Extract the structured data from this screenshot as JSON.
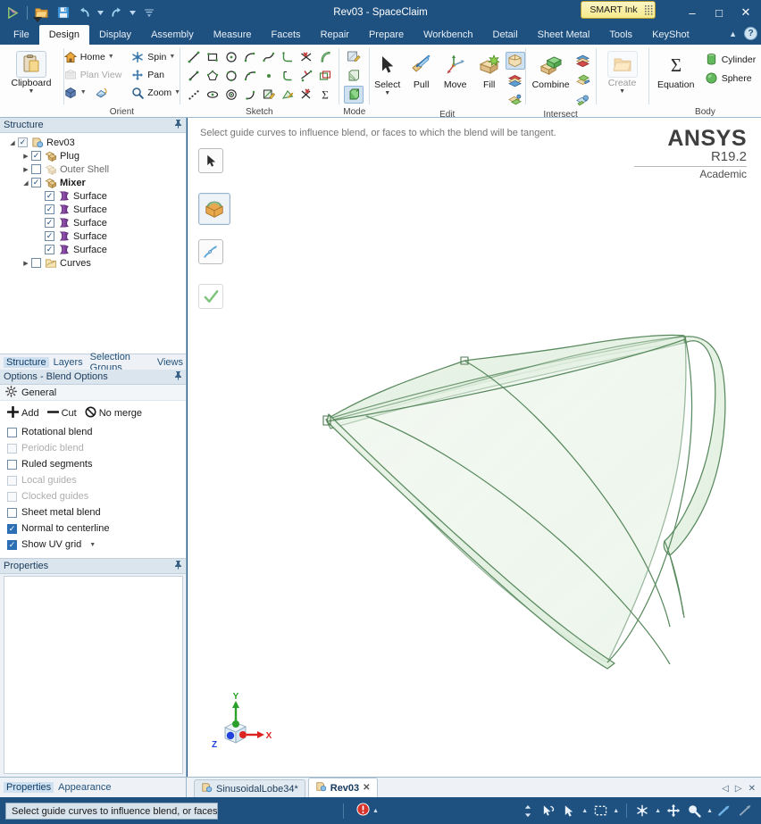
{
  "window": {
    "title": "Rev03 - SpaceClaim",
    "minimize": "–",
    "maximize": "□",
    "close": "✕"
  },
  "quick_access": {
    "items": [
      {
        "name": "app-menu-icon",
        "label": ""
      },
      {
        "name": "open-icon",
        "label": ""
      },
      {
        "name": "save-icon",
        "label": ""
      },
      {
        "name": "undo-icon",
        "label": ""
      },
      {
        "name": "redo-icon",
        "label": ""
      },
      {
        "name": "customize-qat-icon",
        "label": ""
      }
    ]
  },
  "smart_ink": {
    "label": "SMART Ink",
    "grip": "grip-icon"
  },
  "ribbon_tabs": {
    "items": [
      {
        "label": "File",
        "active": false
      },
      {
        "label": "Design",
        "active": true
      },
      {
        "label": "Display",
        "active": false
      },
      {
        "label": "Assembly",
        "active": false
      },
      {
        "label": "Measure",
        "active": false
      },
      {
        "label": "Facets",
        "active": false
      },
      {
        "label": "Repair",
        "active": false
      },
      {
        "label": "Prepare",
        "active": false
      },
      {
        "label": "Workbench",
        "active": false
      },
      {
        "label": "Detail",
        "active": false
      },
      {
        "label": "Sheet Metal",
        "active": false
      },
      {
        "label": "Tools",
        "active": false
      },
      {
        "label": "KeyShot",
        "active": false
      }
    ],
    "collapse": "▲",
    "help": "?"
  },
  "ribbon": {
    "clipboard": {
      "group_label": "",
      "button_label": "Clipboard",
      "caret": "▼"
    },
    "orient": {
      "group_label": "Orient",
      "items": [
        {
          "label": "Home",
          "icon": "home-icon",
          "caret": "▼",
          "disabled": false
        },
        {
          "label": "Spin",
          "icon": "spin-icon",
          "caret": "▼",
          "disabled": false
        },
        {
          "label": "Plan View",
          "icon": "plan-view-icon",
          "caret": "",
          "disabled": true
        },
        {
          "label": "Pan",
          "icon": "pan-icon",
          "caret": "",
          "disabled": false
        },
        {
          "label": "",
          "icon": "isometric-view-icon",
          "caret": "▼",
          "disabled": false
        },
        {
          "label": "",
          "icon": "view-orientation-icon",
          "caret": "",
          "disabled": false
        },
        {
          "label": "Zoom",
          "icon": "zoom-icon",
          "caret": "▼",
          "disabled": false
        }
      ]
    },
    "sketch": {
      "group_label": "Sketch",
      "icons": [
        "line-icon",
        "rectangle-icon",
        "circle-icon",
        "tangent-arc-icon",
        "spline-icon",
        "corner-arc-icon",
        "trim-away-icon",
        "arc-slice-icon",
        "construction-line-icon",
        "polygon-icon",
        "three-point-circle-icon",
        "three-point-arc-icon",
        "point-icon",
        "fillet-icon",
        "split-icon",
        "offset-icon",
        "dashed-line-icon",
        "ellipse-icon",
        "concentric-circle-icon",
        "sweep-arc-icon",
        "sketch-edit-icon",
        "project-icon",
        "trim-icon",
        "equation-curve-icon"
      ]
    },
    "mode": {
      "group_label": "Mode",
      "icons": [
        {
          "name": "sketch-mode-icon",
          "selected": false
        },
        {
          "name": "section-mode-icon",
          "selected": false
        },
        {
          "name": "three-d-mode-icon",
          "selected": true
        }
      ]
    },
    "edit": {
      "group_label": "Edit",
      "items": [
        {
          "label": "Select",
          "icon": "select-arrow-icon",
          "caret": "▼"
        },
        {
          "label": "Pull",
          "icon": "pull-icon",
          "caret": ""
        },
        {
          "label": "Move",
          "icon": "move-icon",
          "caret": ""
        },
        {
          "label": "Fill",
          "icon": "fill-icon",
          "caret": ""
        }
      ],
      "stack": [
        {
          "name": "blend-icon",
          "selected": true
        },
        {
          "name": "shell-icon",
          "selected": false
        },
        {
          "name": "split-body-icon",
          "selected": false
        }
      ]
    },
    "intersect": {
      "group_label": "Intersect",
      "items": [
        {
          "label": "Combine",
          "icon": "combine-icon"
        }
      ],
      "stack": [
        {
          "name": "split-solid-icon",
          "selected": false
        },
        {
          "name": "project-to-solid-icon",
          "selected": false
        },
        {
          "name": "interference-icon",
          "selected": false
        }
      ]
    },
    "create": {
      "group_label": "",
      "button_label": "Create",
      "icon": "create-folder-icon",
      "caret": "▼"
    },
    "body": {
      "group_label": "Body",
      "items": [
        {
          "label": "Equation",
          "icon": "equation-sigma-icon"
        },
        {
          "label": "Cylinder",
          "icon": "cylinder-icon"
        },
        {
          "label": "Sphere",
          "icon": "sphere-icon"
        }
      ]
    }
  },
  "structure_panel": {
    "header": "Structure",
    "pin": "pin-icon",
    "tree": [
      {
        "label": "Rev03",
        "indent": 0,
        "expander": "▲",
        "checked": true,
        "gray": true,
        "icon": "document-icon",
        "bold": false,
        "dim": false
      },
      {
        "label": "Plug",
        "indent": 1,
        "expander": "▶",
        "checked": true,
        "gray": false,
        "icon": "component-icon",
        "bold": false,
        "dim": false
      },
      {
        "label": "Outer Shell",
        "indent": 1,
        "expander": "▶",
        "checked": false,
        "gray": false,
        "icon": "component-dim-icon",
        "bold": false,
        "dim": true
      },
      {
        "label": "Mixer",
        "indent": 1,
        "expander": "▲",
        "checked": true,
        "gray": false,
        "icon": "component-icon",
        "bold": true,
        "dim": false
      },
      {
        "label": "Surface",
        "indent": 2,
        "expander": "",
        "checked": true,
        "gray": false,
        "icon": "surface-icon",
        "bold": false,
        "dim": false
      },
      {
        "label": "Surface",
        "indent": 2,
        "expander": "",
        "checked": true,
        "gray": false,
        "icon": "surface-icon",
        "bold": false,
        "dim": false
      },
      {
        "label": "Surface",
        "indent": 2,
        "expander": "",
        "checked": true,
        "gray": false,
        "icon": "surface-icon",
        "bold": false,
        "dim": false
      },
      {
        "label": "Surface",
        "indent": 2,
        "expander": "",
        "checked": true,
        "gray": false,
        "icon": "surface-icon",
        "bold": false,
        "dim": false
      },
      {
        "label": "Surface",
        "indent": 2,
        "expander": "",
        "checked": true,
        "gray": false,
        "icon": "surface-icon",
        "bold": false,
        "dim": false
      },
      {
        "label": "Curves",
        "indent": 1,
        "expander": "▶",
        "checked": false,
        "gray": false,
        "icon": "curves-folder-icon",
        "bold": false,
        "dim": false
      }
    ],
    "tabs": [
      {
        "label": "Structure",
        "active": true
      },
      {
        "label": "Layers",
        "active": false
      },
      {
        "label": "Selection Groups",
        "active": false
      },
      {
        "label": "Views",
        "active": false
      }
    ]
  },
  "options_panel": {
    "header": "Options - Blend Options",
    "pin": "pin-icon",
    "general_label": "General",
    "general_icon": "gear-icon",
    "actions": [
      {
        "label": "Add",
        "icon": "plus-icon"
      },
      {
        "label": "Cut",
        "icon": "minus-icon"
      },
      {
        "label": "No merge",
        "icon": "no-merge-icon"
      }
    ],
    "checkboxes": [
      {
        "label": "Rotational blend",
        "checked": false,
        "disabled": false
      },
      {
        "label": "Periodic blend",
        "checked": false,
        "disabled": true
      },
      {
        "label": "Ruled segments",
        "checked": false,
        "disabled": false
      },
      {
        "label": "Local guides",
        "checked": false,
        "disabled": true
      },
      {
        "label": "Clocked guides",
        "checked": false,
        "disabled": true
      },
      {
        "label": "Sheet metal blend",
        "checked": false,
        "disabled": false
      },
      {
        "label": "Normal to centerline",
        "checked": true,
        "disabled": false
      },
      {
        "label": "Show UV grid",
        "checked": true,
        "disabled": false,
        "caret": "▼"
      }
    ]
  },
  "properties_panel": {
    "header": "Properties",
    "pin": "pin-icon",
    "tabs": [
      {
        "label": "Properties",
        "active": true
      },
      {
        "label": "Appearance",
        "active": false
      }
    ]
  },
  "viewport": {
    "prompt": "Select guide curves to influence blend, or faces to which the blend will be tangent.",
    "tools": [
      {
        "name": "select-tool-icon",
        "selected": false,
        "style": "small"
      },
      {
        "name": "blend-tool-icon",
        "selected": true,
        "style": "big"
      },
      {
        "name": "guide-curve-tool-icon",
        "selected": false,
        "style": "small"
      },
      {
        "name": "complete-tool-icon",
        "selected": false,
        "style": "plain"
      }
    ],
    "watermark": {
      "name": "ANSYS",
      "release": "R19.2",
      "license": "Academic"
    },
    "triad": {
      "x": "X",
      "y": "Y",
      "z": "Z"
    },
    "model_color": "#5a8a5f",
    "model_fill": "#e8f2e6"
  },
  "document_tabs": [
    {
      "label": "SinusoidalLobe34*",
      "active": false,
      "icon": "document-icon",
      "close": ""
    },
    {
      "label": "Rev03",
      "active": true,
      "icon": "document-icon",
      "close": "✕"
    }
  ],
  "tab_navs": {
    "prev": "◁",
    "next": "▷",
    "close": "✕"
  },
  "statusbar": {
    "message": "Select guide curves to influence blend, or faces to whi",
    "error_icon": "error-icon",
    "error_caret": "▲",
    "tools": [
      {
        "name": "resize-handle-icon",
        "caret": ""
      },
      {
        "name": "select-back-icon",
        "caret": ""
      },
      {
        "name": "select-arrow-icon",
        "caret": "▲"
      },
      {
        "name": "box-select-icon",
        "caret": "▲"
      },
      {
        "name": "spin-icon",
        "caret": "▲"
      },
      {
        "name": "pan-icon",
        "caret": ""
      },
      {
        "name": "zoom-icon",
        "caret": "▲"
      },
      {
        "name": "zoom-extents-icon",
        "caret": ""
      },
      {
        "name": "fly-through-icon",
        "caret": ""
      }
    ]
  },
  "colors": {
    "chrome": "#1f5180",
    "ribbon_bg": "#fdfdfd",
    "panel_bg": "#eef2f6",
    "accent": "#2c6fb5",
    "model_green": "#5a8a5f",
    "smart_ink": "#f6e98a"
  }
}
